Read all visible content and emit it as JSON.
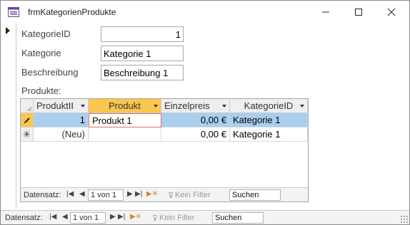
{
  "window": {
    "title": "frmKategorienProdukte"
  },
  "form": {
    "kategorie_id": {
      "label": "KategorieID",
      "value": "1"
    },
    "kategorie": {
      "label": "Kategorie",
      "value": "Kategorie 1"
    },
    "beschreibung": {
      "label": "Beschreibung",
      "value": "Beschreibung 1"
    },
    "subform_label": "Produkte:"
  },
  "subform": {
    "columns": [
      "ProduktII",
      "Produkt",
      "Einzelpreis",
      "KategorieID"
    ],
    "rows": [
      {
        "selector": "pencil",
        "produkt_id": "1",
        "produkt": "Produkt 1",
        "einzelpreis": "0,00 €",
        "kategorie_id": "Kategorie 1"
      },
      {
        "selector": "new",
        "produkt_id": "(Neu)",
        "produkt": "",
        "einzelpreis": "0,00 €",
        "kategorie_id": "Kategorie 1"
      }
    ],
    "navigation": {
      "label": "Datensatz:",
      "record": "1 von 1",
      "filter": "Kein Filter",
      "search": "Suchen"
    }
  },
  "main_navigation": {
    "label": "Datensatz:",
    "record": "1 von 1",
    "filter": "Kein Filter",
    "search": "Suchen"
  },
  "colors": {
    "active_header": "#f9c74f",
    "selected_row": "#a9cfee",
    "edit_border": "#e06b6b"
  }
}
